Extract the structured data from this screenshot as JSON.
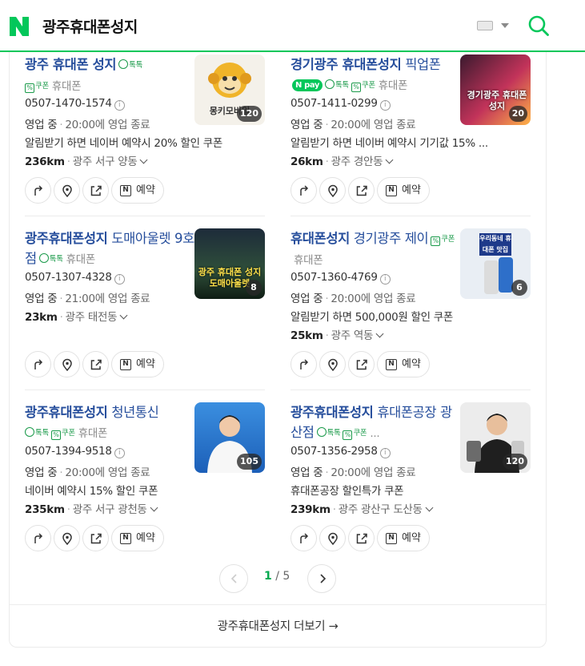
{
  "header": {
    "query": "광주휴대폰성지",
    "logo_icon": "naver-n-logo",
    "brand_color": "#03c75a"
  },
  "results": [
    {
      "title_strong": "광주 휴대폰 성지",
      "title_rest": "",
      "tags": [
        "톡톡",
        "쿠폰"
      ],
      "npay": false,
      "category": "휴대폰",
      "phone": "0507-1470-1574",
      "status": "영업 중",
      "hours": "20:00에 영업 종료",
      "promo": "알림받기 하면 네이버 예약시 20% 할인 쿠폰",
      "distance": "236km",
      "address": "광주 서구 양동",
      "photo_count": "120",
      "thumb_text": "몽키모바일"
    },
    {
      "title_strong": "경기광주 휴대폰성지",
      "title_rest": " 픽업폰",
      "tags": [
        "톡톡",
        "쿠폰"
      ],
      "npay": true,
      "npay_label": "pay",
      "category": "휴대폰",
      "phone": "0507-1411-0299",
      "status": "영업 중",
      "hours": "20:00에 영업 종료",
      "promo": "알림받기 하면 네이버 예약시 기기값 15% ...",
      "distance": "26km",
      "address": "광주 경안동",
      "photo_count": "20",
      "thumb_text": "경기광주 휴대폰성지"
    },
    {
      "title_strong": "광주휴대폰성지",
      "title_rest": " 도매아울렛 9호점",
      "tags": [
        "톡톡"
      ],
      "npay": false,
      "category": "휴대폰",
      "phone": "0507-1307-4328",
      "status": "영업 중",
      "hours": "21:00에 영업 종료",
      "promo": "",
      "distance": "23km",
      "address": "광주 태전동",
      "photo_count": "8",
      "thumb_text": "광주 휴대폰 성지 도매아울렛"
    },
    {
      "title_strong": "휴대폰성지",
      "title_rest": " 경기광주 제이",
      "tags": [
        "쿠폰"
      ],
      "npay": false,
      "category": "휴대폰",
      "phone": "0507-1360-4769",
      "status": "영업 중",
      "hours": "20:00에 영업 종료",
      "promo": "알림받기 하면 500,000원 할인 쿠폰",
      "distance": "25km",
      "address": "광주 역동",
      "photo_count": "6",
      "thumb_text": "우리동네 휴대폰 맛집"
    },
    {
      "title_strong": "광주휴대폰성지",
      "title_rest": " 청년통신",
      "tags": [
        "톡톡",
        "쿠폰"
      ],
      "npay": false,
      "category": "휴대폰",
      "phone": "0507-1394-9518",
      "status": "영업 중",
      "hours": "20:00에 영업 종료",
      "promo": "네이버 예약시 15% 할인 쿠폰",
      "distance": "235km",
      "address": "광주 서구 광천동",
      "photo_count": "105",
      "thumb_text": ""
    },
    {
      "title_strong": "광주휴대폰성지",
      "title_rest": " 휴대폰공장 광산점",
      "tags": [
        "톡톡",
        "쿠폰"
      ],
      "npay": false,
      "tags_more": "...",
      "category": "",
      "phone": "0507-1356-2958",
      "status": "영업 중",
      "hours": "20:00에 영업 종료",
      "promo": "휴대폰공장 할인특가 쿠폰",
      "distance": "239km",
      "address": "광주 광산구 도산동",
      "photo_count": "120",
      "thumb_text": ""
    }
  ],
  "action_labels": {
    "reserve": "예약",
    "naver_n": "N"
  },
  "pagination": {
    "current": "1",
    "separator": "/",
    "total": "5"
  },
  "more_link": "광주휴대폰성지 더보기 →"
}
